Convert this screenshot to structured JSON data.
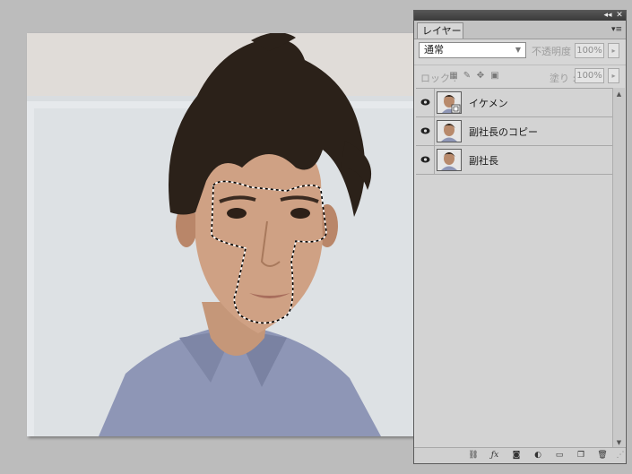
{
  "canvas": {
    "alt": "photo"
  },
  "panel": {
    "collapse_icon": "double-chevron-left-icon",
    "close_icon": "close-icon",
    "tab_label": "レイヤー",
    "menu_icon": "panel-menu-icon",
    "blend_mode": "通常",
    "opacity_label": "不透明度 :",
    "opacity_value": "100%",
    "lock_label": "ロック :",
    "fill_label": "塗り :",
    "fill_value": "100%",
    "layers": [
      {
        "name": "イケメン",
        "visible": true,
        "smart_object": true
      },
      {
        "name": "副社長のコピー",
        "visible": true,
        "smart_object": false
      },
      {
        "name": "副社長",
        "visible": true,
        "smart_object": false
      }
    ],
    "bottom_icons": [
      "link-icon",
      "fx-icon",
      "mask-icon",
      "adjustment-icon",
      "folder-icon",
      "new-layer-icon",
      "trash-icon"
    ]
  },
  "colors": {
    "panel_bg": "#d6d6d6",
    "titlebar": "#444444",
    "workspace": "#bcbcbc"
  }
}
